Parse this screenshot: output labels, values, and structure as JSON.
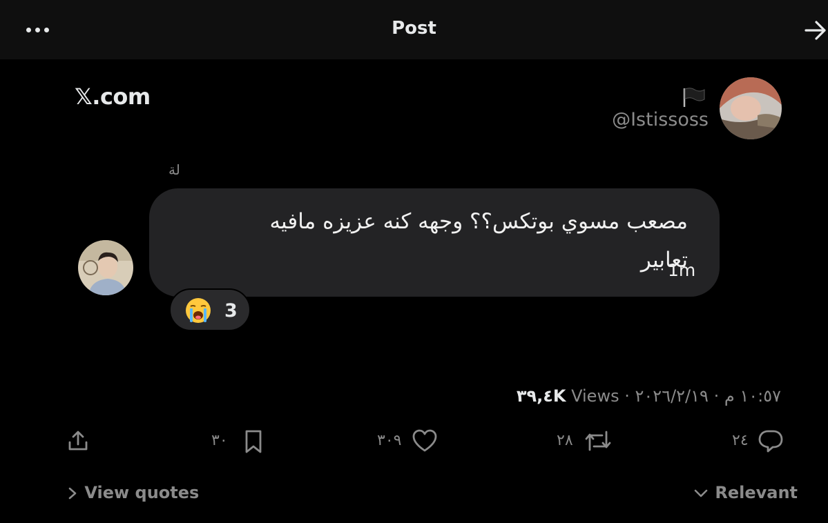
{
  "header": {
    "title": "Post"
  },
  "post": {
    "brand": "𝕏.com",
    "author_handle": "@Istissoss",
    "reply_label": "لة",
    "message_line1": "مصعب مسوي بوتكس؟؟ وجهه كنه عزيزه مافيه",
    "message_line2": "تعابير",
    "message_time": "1m",
    "reaction": {
      "emoji": "loudly-crying-face",
      "count": "3"
    }
  },
  "meta": {
    "date": "٢٠٢٦/٢/١٩",
    "time": "١٠:٥٧ م",
    "views_count": "٣٩,٤K",
    "views_label": "Views"
  },
  "actions": {
    "replies": "٢٤",
    "reposts": "٢٨",
    "likes": "٣٠٩",
    "bookmarks": "٣٠"
  },
  "footer": {
    "view_quotes": "View quotes",
    "sort": "Relevant"
  },
  "colors": {
    "background": "#000000",
    "header_bg": "#0f0f0f",
    "bubble": "#232325",
    "muted": "#8b8b8b",
    "text": "#e7e9ea"
  }
}
